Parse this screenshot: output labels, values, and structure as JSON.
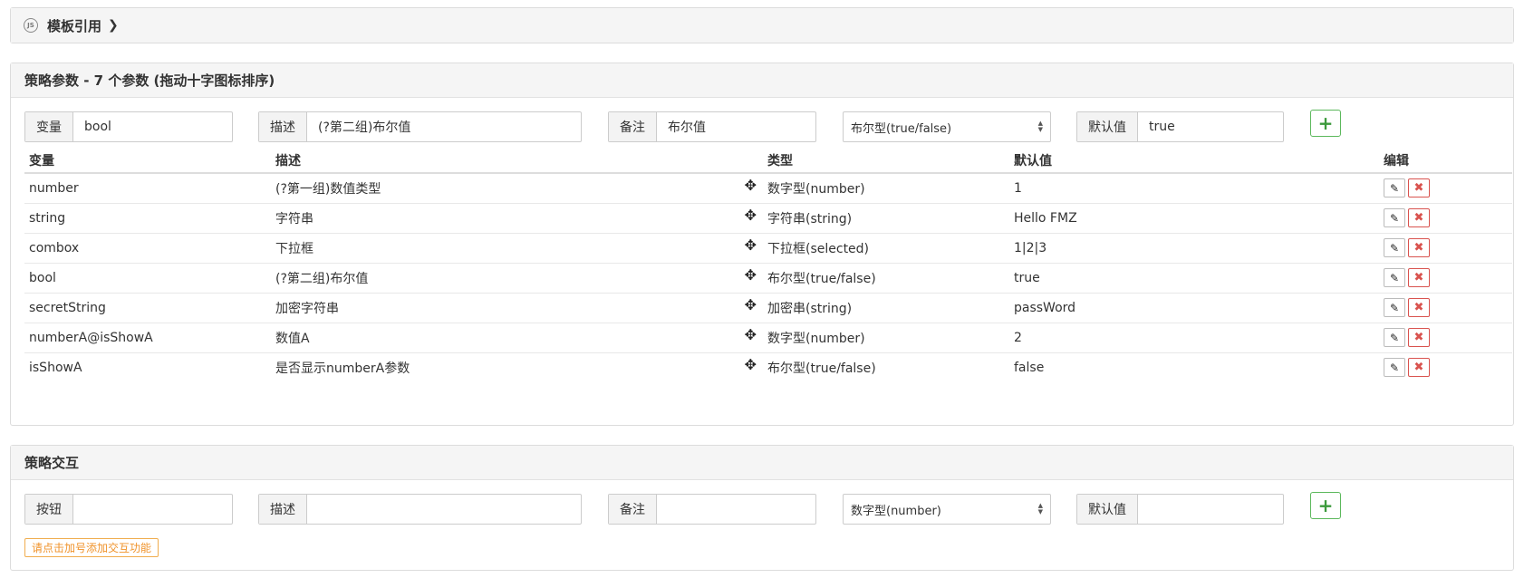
{
  "template_panel": {
    "title": "模板引用",
    "chevron": "❯"
  },
  "params_panel": {
    "title": "策略参数 - 7 个参数 (拖动十字图标排序)",
    "form": {
      "var_label": "变量",
      "var_value": "bool",
      "desc_label": "描述",
      "desc_value": "(?第二组)布尔值",
      "note_label": "备注",
      "note_value": "布尔值",
      "type_value": "布尔型(true/false)",
      "default_label": "默认值",
      "default_value": "true",
      "add": "+"
    },
    "columns": [
      "变量",
      "描述",
      "类型",
      "默认值",
      "编辑"
    ],
    "rows": [
      {
        "var": "number",
        "desc": "(?第一组)数值类型",
        "type": "数字型(number)",
        "default": "1"
      },
      {
        "var": "string",
        "desc": "字符串",
        "type": "字符串(string)",
        "default": "Hello FMZ"
      },
      {
        "var": "combox",
        "desc": "下拉框",
        "type": "下拉框(selected)",
        "default": "1|2|3"
      },
      {
        "var": "bool",
        "desc": "(?第二组)布尔值",
        "type": "布尔型(true/false)",
        "default": "true"
      },
      {
        "var": "secretString",
        "desc": "加密字符串",
        "type": "加密串(string)",
        "default": "passWord"
      },
      {
        "var": "numberA@isShowA",
        "desc": "数值A",
        "type": "数字型(number)",
        "default": "2"
      },
      {
        "var": "isShowA",
        "desc": "是否显示numberA参数",
        "type": "布尔型(true/false)",
        "default": "false"
      }
    ],
    "icons": {
      "move": "move-icon",
      "edit": "pencil-icon",
      "delete": "close-icon"
    }
  },
  "interact_panel": {
    "title": "策略交互",
    "form": {
      "btn_label": "按钮",
      "btn_value": "",
      "desc_label": "描述",
      "desc_value": "",
      "note_label": "备注",
      "note_value": "",
      "type_value": "数字型(number)",
      "default_label": "默认值",
      "default_value": "",
      "add": "+"
    },
    "hint": "请点击加号添加交互功能"
  }
}
